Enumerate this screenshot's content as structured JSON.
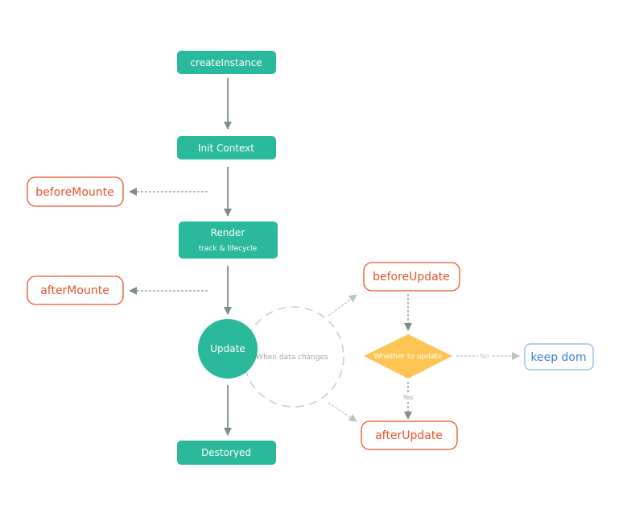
{
  "colors": {
    "primary": "#2ab99a",
    "hook": "#e8542a",
    "decision": "#ffc552",
    "keep": "#3a7fde",
    "arrow": "#7f8c87",
    "light_arrow": "#b9c6c0"
  },
  "nodes": {
    "create_instance": "createInstance",
    "init_context": "Init Context",
    "render": "Render",
    "render_sub": "track & lifecycle",
    "update": "Update",
    "destroyed": "Destoryed",
    "before_mount": "beforeMounte",
    "after_mount": "afterMounte",
    "before_update": "beforeUpdate",
    "after_update": "afterUpdate",
    "decision": "Whether to update",
    "keep_dom": "keep dom"
  },
  "edges": {
    "data_changes": "When data changes",
    "no": "No",
    "yes": "Yes"
  }
}
